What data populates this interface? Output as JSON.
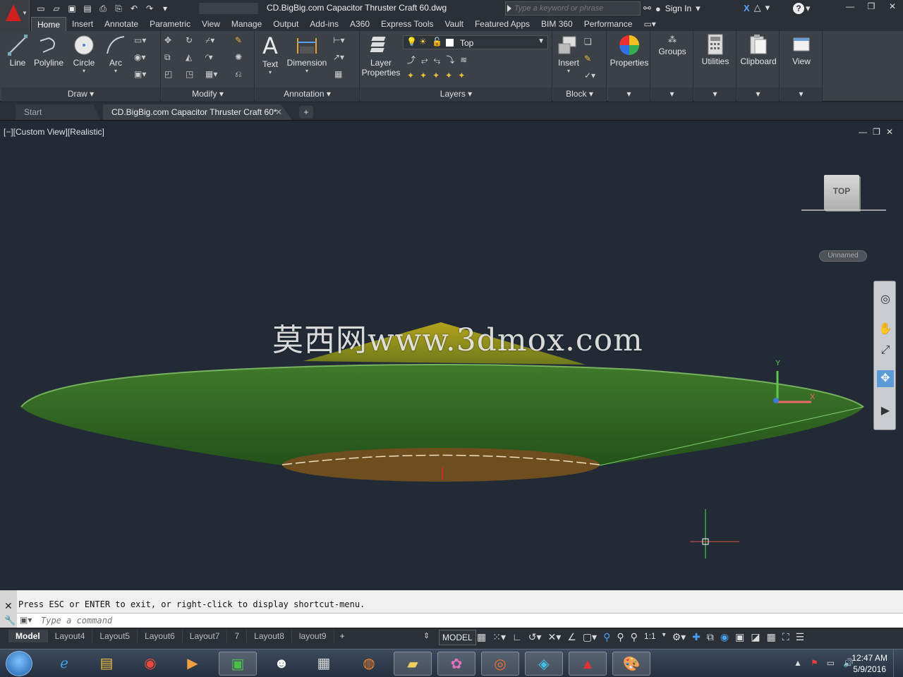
{
  "titlebar": {
    "doc_title": "CD.BigBig.com Capacitor Thruster Craft 60.dwg",
    "search_placeholder": "Type a keyword or phrase",
    "sign_in": "Sign In"
  },
  "ribbon_tabs": [
    "Home",
    "Insert",
    "Annotate",
    "Parametric",
    "View",
    "Manage",
    "Output",
    "Add-ins",
    "A360",
    "Express Tools",
    "Vault",
    "Featured Apps",
    "BIM 360",
    "Performance"
  ],
  "ribbon": {
    "draw": {
      "title": "Draw",
      "line": "Line",
      "polyline": "Polyline",
      "circle": "Circle",
      "arc": "Arc"
    },
    "modify": {
      "title": "Modify"
    },
    "annotation": {
      "title": "Annotation",
      "text": "Text",
      "dimension": "Dimension"
    },
    "layers": {
      "title": "Layers",
      "layer_properties_1": "Layer",
      "layer_properties_2": "Properties",
      "current_layer": "Top"
    },
    "block": {
      "title": "Block",
      "insert": "Insert"
    },
    "properties": "Properties",
    "groups": "Groups",
    "utilities": "Utilities",
    "clipboard": "Clipboard",
    "view": "View"
  },
  "file_tabs": {
    "start": "Start",
    "doc": "CD.BigBig.com Capacitor Thruster Craft 60*",
    "close": "✕",
    "new": "+"
  },
  "viewport": {
    "label": "[−][Custom View][Realistic]",
    "watermark": "莫西网www.3dmox.com",
    "viewcube": "TOP",
    "ucs": "Unnamed",
    "axis_x": "X",
    "axis_y": "Y"
  },
  "command": {
    "message": "Press ESC or ENTER to exit, or right-click to display shortcut-menu.",
    "placeholder": "Type a command"
  },
  "layout_tabs": [
    "Model",
    "Layout4",
    "Layout5",
    "Layout6",
    "Layout7",
    "7",
    "Layout8",
    "layout9"
  ],
  "statusbar": {
    "model": "MODEL",
    "scale": "1:1"
  },
  "taskbar": {
    "time": "12:47 AM",
    "date": "5/9/2016"
  },
  "colors": {
    "saucer_top": "#2e6a1e",
    "saucer_bottom": "#6e4e1f",
    "viewport_bg": "#222a36",
    "accent_blue": "#4aa0f0"
  }
}
